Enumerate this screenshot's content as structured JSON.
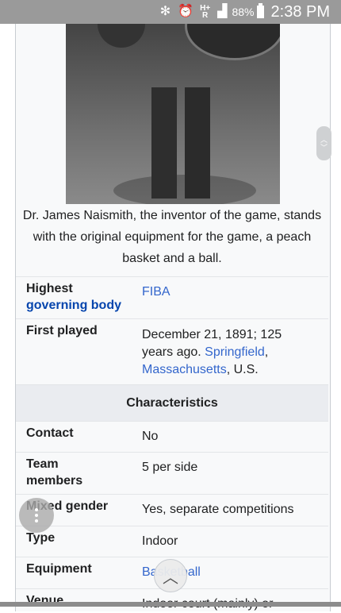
{
  "status_bar": {
    "bluetooth_icon": "bluetooth-icon",
    "alarm_icon": "alarm-icon",
    "network_type_top": "H+",
    "network_type_bottom": "R",
    "battery_percent": "88%",
    "time": "2:38 PM"
  },
  "caption": "Dr. James Naismith, the inventor of the game, stands with the original equipment for the game, a peach basket and a ball.",
  "infobox": {
    "highest_governing_body": {
      "label_line1": "Highest",
      "label_line2": "governing body",
      "value": "FIBA"
    },
    "first_played": {
      "label": "First played",
      "value_prefix": "December 21, 1891; 125 years ago.",
      "link1": "Springfield",
      "sep": ",",
      "link2": "Massachusetts",
      "suffix": ", U.S."
    },
    "section_title": "Characteristics",
    "rows": [
      {
        "label": "Contact",
        "value": "No"
      },
      {
        "label": "Team members",
        "value": "5 per side"
      },
      {
        "label": "Mixed gender",
        "value": "Yes, separate competitions"
      },
      {
        "label": "Type",
        "value": "Indoor"
      },
      {
        "label": "Equipment",
        "value": "Basketball"
      },
      {
        "label": "Venue",
        "value": "Indoor court (mainly) or"
      }
    ]
  },
  "controls": {
    "menu_icon": "more-vertical-icon",
    "scroll_top_icon": "chevron-up-icon",
    "scroll_handle_icon": "scroll-handle-icon"
  }
}
